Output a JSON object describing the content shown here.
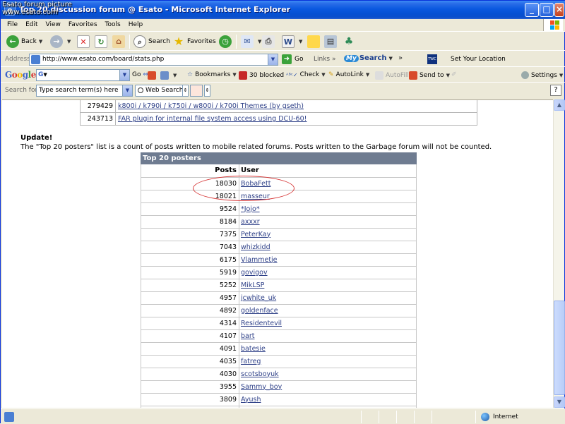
{
  "watermark": {
    "line1": "Esato forum picture",
    "line2": "www.esato.com"
  },
  "window": {
    "title": "Top 20 discussion forum @ Esato - Microsoft Internet Explorer"
  },
  "menubar": {
    "items": [
      "File",
      "Edit",
      "View",
      "Favorites",
      "Tools",
      "Help"
    ]
  },
  "toolbar": {
    "back": "Back",
    "search": "Search",
    "favorites": "Favorites"
  },
  "address": {
    "label": "Address",
    "url": "http://www.esato.com/board/stats.php",
    "go": "Go",
    "links": "Links",
    "mysearch_my": "My",
    "mysearch_text": "Search",
    "twc": "TWC",
    "set_location": "Set Your Location"
  },
  "googlebar": {
    "logo": "Google",
    "field_prefix": "G",
    "go": "Go",
    "bookmarks": "Bookmarks",
    "blocked": "30 blocked",
    "check": "Check",
    "autolink": "AutoLink",
    "autofill": "AutoFill",
    "sendto": "Send to",
    "settings": "Settings"
  },
  "searchbar": {
    "label": "Search for",
    "placeholder": "Type search term(s) here",
    "web_search": "Web Search",
    "help": "?"
  },
  "top_table": {
    "rows": [
      {
        "count": "279429",
        "title": "k800i / k790i / k750i / w800i / k700i Themes (by gseth)"
      },
      {
        "count": "243713",
        "title": "FAR plugin for internal file system access using DCU-60!"
      }
    ]
  },
  "update": {
    "title": "Update!",
    "text": "The \"Top 20 posters\" list is a count of posts written to mobile related forums. Posts written to the Garbage forum will not be counted."
  },
  "posters": {
    "header": "Top 20 posters",
    "col_posts": "Posts",
    "col_user": "User",
    "rows": [
      {
        "posts": "18030",
        "user": "BobaFett"
      },
      {
        "posts": "18021",
        "user": "masseur"
      },
      {
        "posts": "9524",
        "user": "*Jojo*"
      },
      {
        "posts": "8184",
        "user": "axxxr"
      },
      {
        "posts": "7375",
        "user": "PeterKay"
      },
      {
        "posts": "7043",
        "user": "whizkidd"
      },
      {
        "posts": "6175",
        "user": "Vlammetje"
      },
      {
        "posts": "5919",
        "user": "govigov"
      },
      {
        "posts": "5252",
        "user": "MikLSP"
      },
      {
        "posts": "4957",
        "user": "jcwhite_uk"
      },
      {
        "posts": "4892",
        "user": "goldenface"
      },
      {
        "posts": "4314",
        "user": "Residentevil"
      },
      {
        "posts": "4107",
        "user": "bart"
      },
      {
        "posts": "4091",
        "user": "batesie"
      },
      {
        "posts": "4035",
        "user": "fatreg"
      },
      {
        "posts": "4030",
        "user": "scotsboyuk"
      },
      {
        "posts": "3955",
        "user": "Sammy_boy"
      },
      {
        "posts": "3809",
        "user": "Ayush"
      }
    ]
  },
  "status": {
    "zone": "Internet"
  },
  "colors": {
    "title_bar": "#0A58E0",
    "table_header": "#6F7C91",
    "link": "#2d3f87",
    "highlight_oval": "#D63737"
  }
}
